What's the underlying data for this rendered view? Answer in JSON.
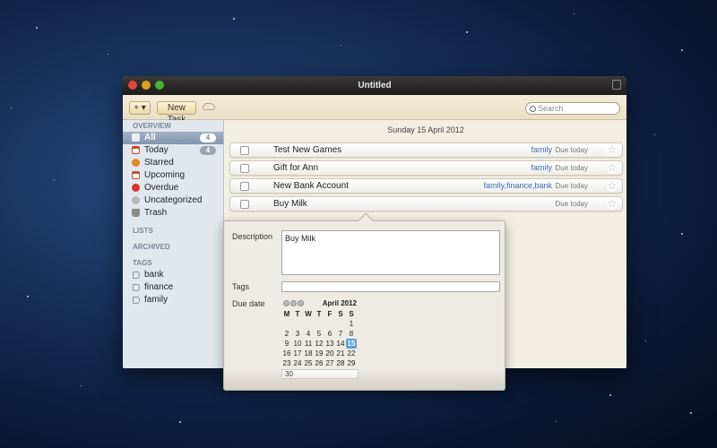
{
  "window": {
    "title": "Untitled"
  },
  "toolbar": {
    "add_label": "+ ▾",
    "new_task_label": "New Task",
    "search_placeholder": "Search"
  },
  "sidebar": {
    "overview_header": "OVERVIEW",
    "items": [
      {
        "label": "All",
        "badge": "4",
        "icon": "inbox-icon",
        "color": "#8c97a8"
      },
      {
        "label": "Today",
        "badge": "4",
        "icon": "calendar-icon",
        "color": "#d8412f"
      },
      {
        "label": "Starred",
        "badge": "",
        "icon": "star-icon",
        "color": "#e0892b"
      },
      {
        "label": "Upcoming",
        "badge": "",
        "icon": "upcoming-calendar-icon",
        "color": "#c84a3c"
      },
      {
        "label": "Overdue",
        "badge": "",
        "icon": "overdue-icon",
        "color": "#d7322b"
      },
      {
        "label": "Uncategorized",
        "badge": "",
        "icon": "uncategorized-icon",
        "color": "#b8b8b8"
      },
      {
        "label": "Trash",
        "badge": "",
        "icon": "trash-icon",
        "color": "#8a8a8a"
      }
    ],
    "lists_header": "LISTS",
    "archived_header": "ARCHIVED",
    "tags_header": "TAGS",
    "tags": [
      "bank",
      "finance",
      "family"
    ]
  },
  "main": {
    "date_header": "Sunday 15 April 2012",
    "tasks": [
      {
        "title": "Test New Games",
        "tags": "family",
        "due": "Due today"
      },
      {
        "title": "Gift for Ann",
        "tags": "family",
        "due": "Due today"
      },
      {
        "title": "New Bank Account",
        "tags": "family,finance,bank",
        "due": "Due today"
      },
      {
        "title": "Buy Milk",
        "tags": "",
        "due": "Due today"
      }
    ]
  },
  "editor": {
    "description_label": "Description",
    "description_value": "Buy Milk",
    "tags_label": "Tags",
    "tags_value": "",
    "due_label": "Due date",
    "calendar": {
      "month_label": "April 2012",
      "weekdays": [
        "M",
        "T",
        "W",
        "T",
        "F",
        "S",
        "S"
      ],
      "weeks": [
        [
          "",
          "",
          "",
          "",
          "",
          "",
          "1"
        ],
        [
          "2",
          "3",
          "4",
          "5",
          "6",
          "7",
          "8"
        ],
        [
          "9",
          "10",
          "11",
          "12",
          "13",
          "14",
          "15"
        ],
        [
          "16",
          "17",
          "18",
          "19",
          "20",
          "21",
          "22"
        ],
        [
          "23",
          "24",
          "25",
          "26",
          "27",
          "28",
          "29"
        ]
      ],
      "last_row": "30",
      "selected_day": "15"
    }
  }
}
